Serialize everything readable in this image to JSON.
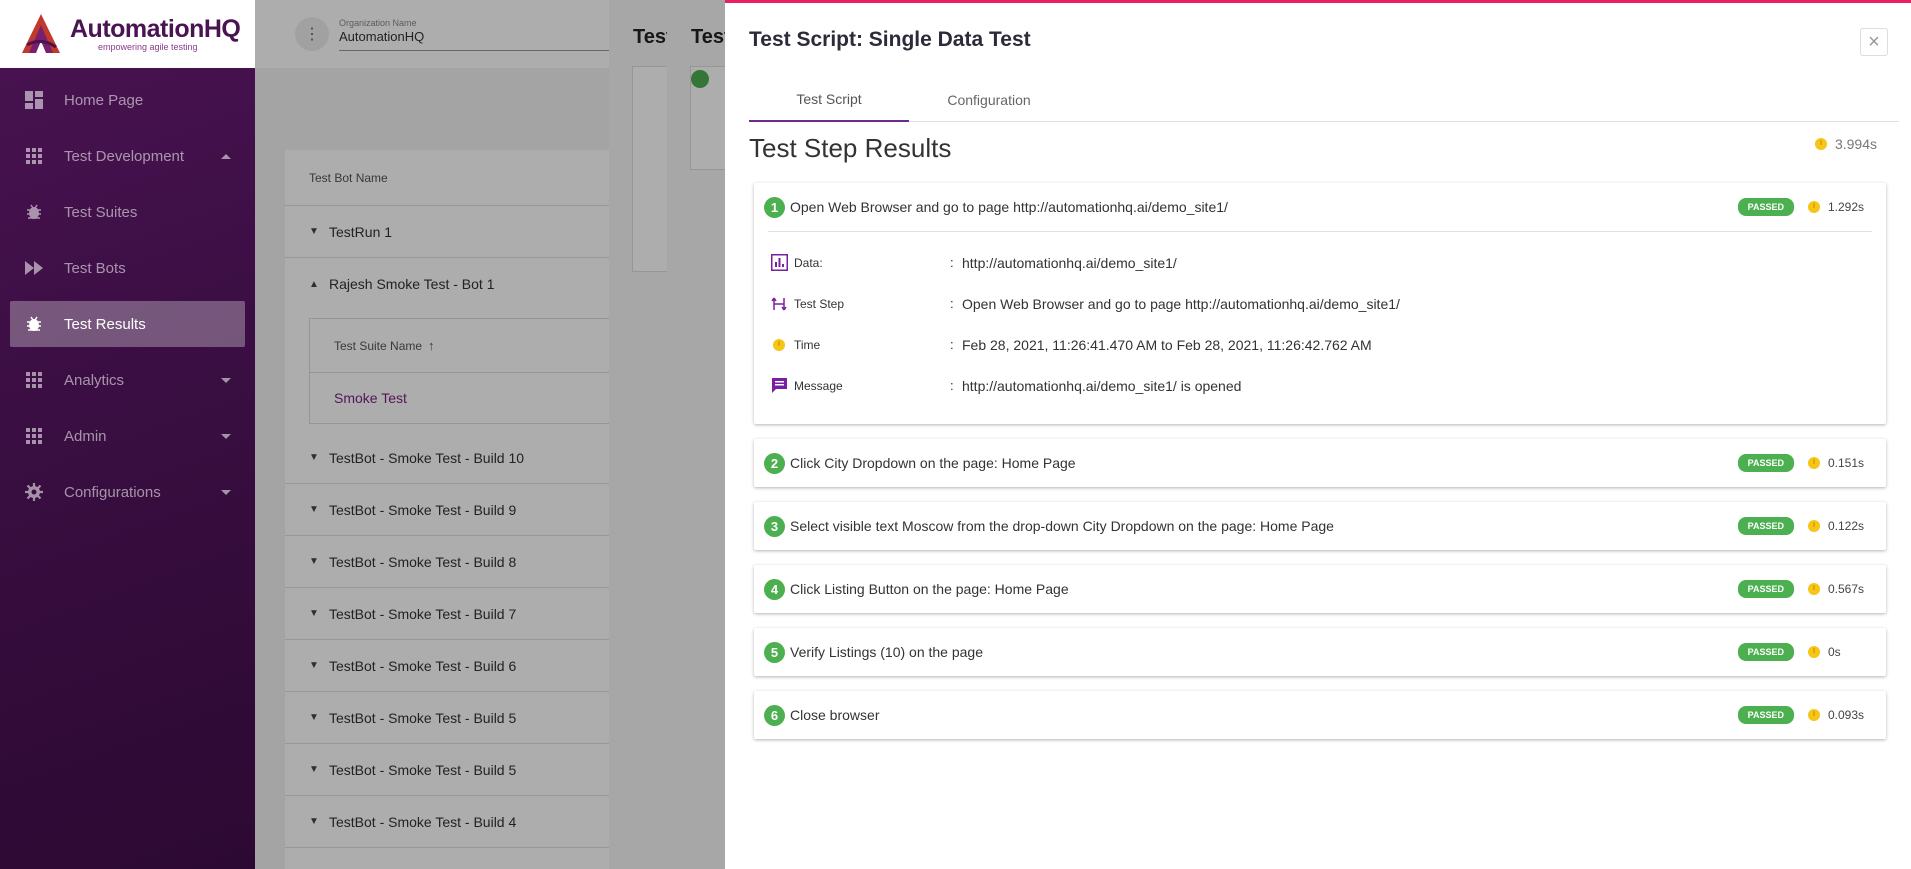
{
  "brand": {
    "name": "AutomationHQ",
    "tagline": "empowering agile testing",
    "primary_color": "#4a1352",
    "accent_color": "#e91e63"
  },
  "sidebar": {
    "items": [
      {
        "label": "Home Page",
        "icon": "dashboard-icon",
        "active": false
      },
      {
        "label": "Test Development",
        "icon": "grid-icon",
        "active": false,
        "caret": "up"
      },
      {
        "label": "Test Suites",
        "icon": "bug-icon",
        "active": false
      },
      {
        "label": "Test Bots",
        "icon": "fast-forward-icon",
        "active": false
      },
      {
        "label": "Test Results",
        "icon": "bug-icon",
        "active": true
      },
      {
        "label": "Analytics",
        "icon": "grid-icon",
        "active": false,
        "caret": "down"
      },
      {
        "label": "Admin",
        "icon": "grid-icon",
        "active": false,
        "caret": "down"
      },
      {
        "label": "Configurations",
        "icon": "gear-icon",
        "active": false,
        "caret": "down"
      }
    ]
  },
  "topbar": {
    "org_label": "Organization Name",
    "org_value": "AutomationHQ"
  },
  "background": {
    "column_header": "Test Bot Name",
    "rows": [
      "TestRun 1",
      "Rajesh Smoke Test - Bot 1"
    ],
    "suite_header": "Test Suite Name",
    "suite_row": "Smoke Test",
    "more_rows": [
      "TestBot - Smoke Test - Build 10",
      "TestBot - Smoke Test - Build 9",
      "TestBot - Smoke Test - Build 8",
      "TestBot - Smoke Test - Build 7",
      "TestBot - Smoke Test - Build 6",
      "TestBot - Smoke Test - Build 5",
      "TestBot - Smoke Test - Build 5",
      "TestBot - Smoke Test - Build 4"
    ],
    "dialog_titles": [
      "Test",
      "Test"
    ]
  },
  "panel": {
    "title": "Test Script: Single Data Test",
    "close_glyph": "×",
    "tabs": [
      {
        "label": "Test Script",
        "active": true
      },
      {
        "label": "Configuration",
        "active": false
      }
    ],
    "results_title": "Test Step Results",
    "total_time": "3.994s",
    "steps": [
      {
        "num": "1",
        "text": "Open Web Browser and go to page http://automationhq.ai/demo_site1/",
        "status": "PASSED",
        "time": "1.292s",
        "expanded": true,
        "details": [
          {
            "icon": "chart-icon",
            "label": "Data:",
            "value": "http://automationhq.ai/demo_site1/"
          },
          {
            "icon": "step-icon",
            "label": "Test Step",
            "value": "Open Web Browser and go to page http://automationhq.ai/demo_site1/"
          },
          {
            "icon": "clock-icon",
            "label": "Time",
            "value": "Feb 28, 2021, 11:26:41.470 AM to Feb 28, 2021, 11:26:42.762 AM"
          },
          {
            "icon": "message-icon",
            "label": "Message",
            "value": "http://automationhq.ai/demo_site1/ is opened"
          }
        ]
      },
      {
        "num": "2",
        "text": "Click City Dropdown on the page: Home Page",
        "status": "PASSED",
        "time": "0.151s",
        "expanded": false
      },
      {
        "num": "3",
        "text": "Select visible text Moscow from the drop-down City Dropdown on the page: Home Page",
        "status": "PASSED",
        "time": "0.122s",
        "expanded": false
      },
      {
        "num": "4",
        "text": "Click Listing Button on the page: Home Page",
        "status": "PASSED",
        "time": "0.567s",
        "expanded": false
      },
      {
        "num": "5",
        "text": "Verify Listings (10) on the page",
        "status": "PASSED",
        "time": "0s",
        "expanded": false
      },
      {
        "num": "6",
        "text": "Close browser",
        "status": "PASSED",
        "time": "0.093s",
        "expanded": false
      }
    ],
    "separator": ":"
  }
}
